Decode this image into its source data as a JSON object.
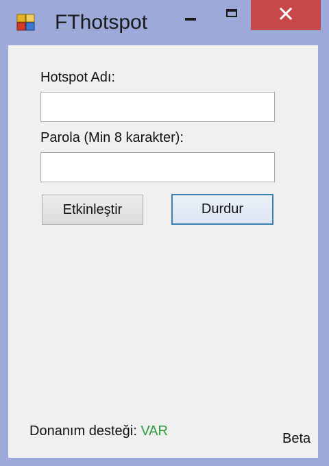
{
  "window": {
    "title": "FThotspot",
    "icon": "fthotspot-app-icon",
    "controls": {
      "minimize": "minimize-icon",
      "maximize": "maximize-icon",
      "close": "close-icon"
    },
    "close_color": "#c7474b"
  },
  "form": {
    "ssid_label": "Hotspot Adı:",
    "ssid_value": "",
    "password_label": "Parola (Min 8 karakter):",
    "password_value": "",
    "start_button": "Etkinleştir",
    "stop_button": "Durdur"
  },
  "status": {
    "hardware_label": "Donanım desteği:",
    "hardware_value": "VAR",
    "hardware_value_color": "#2e9a3e",
    "version": "Beta"
  }
}
